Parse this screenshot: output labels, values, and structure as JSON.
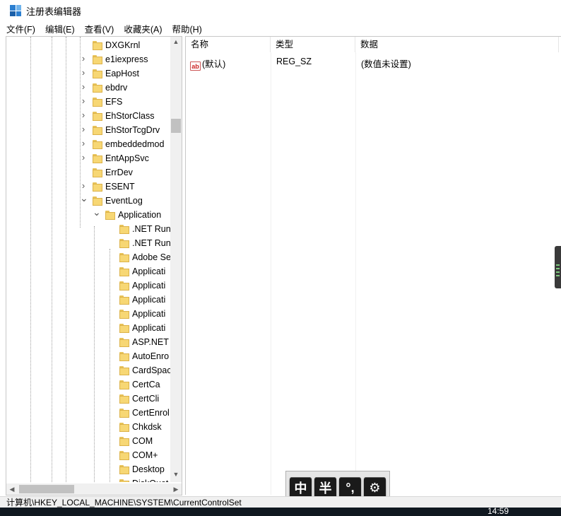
{
  "window": {
    "title": "注册表编辑器"
  },
  "menu": [
    {
      "label": "文件(F)"
    },
    {
      "label": "编辑(E)"
    },
    {
      "label": "查看(V)"
    },
    {
      "label": "收藏夹(A)"
    },
    {
      "label": "帮助(H)"
    }
  ],
  "tree": [
    {
      "label": "DXGKrnl",
      "level": 1,
      "expander": "none"
    },
    {
      "label": "e1iexpress",
      "level": 1,
      "expander": "collapsed"
    },
    {
      "label": "EapHost",
      "level": 1,
      "expander": "collapsed"
    },
    {
      "label": "ebdrv",
      "level": 1,
      "expander": "collapsed"
    },
    {
      "label": "EFS",
      "level": 1,
      "expander": "collapsed"
    },
    {
      "label": "EhStorClass",
      "level": 1,
      "expander": "collapsed"
    },
    {
      "label": "EhStorTcgDrv",
      "level": 1,
      "expander": "collapsed"
    },
    {
      "label": "embeddedmod",
      "level": 1,
      "expander": "collapsed"
    },
    {
      "label": "EntAppSvc",
      "level": 1,
      "expander": "collapsed"
    },
    {
      "label": "ErrDev",
      "level": 1,
      "expander": "none"
    },
    {
      "label": "ESENT",
      "level": 1,
      "expander": "collapsed"
    },
    {
      "label": "EventLog",
      "level": 1,
      "expander": "expanded"
    },
    {
      "label": "Application",
      "level": 2,
      "expander": "expanded"
    },
    {
      "label": ".NET Run",
      "level": 3,
      "expander": "none"
    },
    {
      "label": ".NET Run",
      "level": 3,
      "expander": "none"
    },
    {
      "label": "Adobe Se",
      "level": 3,
      "expander": "none"
    },
    {
      "label": "Applicati",
      "level": 3,
      "expander": "none"
    },
    {
      "label": "Applicati",
      "level": 3,
      "expander": "none"
    },
    {
      "label": "Applicati",
      "level": 3,
      "expander": "none"
    },
    {
      "label": "Applicati",
      "level": 3,
      "expander": "none"
    },
    {
      "label": "Applicati",
      "level": 3,
      "expander": "none"
    },
    {
      "label": "ASP.NET",
      "level": 3,
      "expander": "none"
    },
    {
      "label": "AutoEnro",
      "level": 3,
      "expander": "none"
    },
    {
      "label": "CardSpac",
      "level": 3,
      "expander": "none"
    },
    {
      "label": "CertCa",
      "level": 3,
      "expander": "none"
    },
    {
      "label": "CertCli",
      "level": 3,
      "expander": "none"
    },
    {
      "label": "CertEnrol",
      "level": 3,
      "expander": "none"
    },
    {
      "label": "Chkdsk",
      "level": 3,
      "expander": "none"
    },
    {
      "label": "COM",
      "level": 3,
      "expander": "none"
    },
    {
      "label": "COM+",
      "level": 3,
      "expander": "none"
    },
    {
      "label": "Desktop",
      "level": 3,
      "expander": "none"
    },
    {
      "label": "DiskQuot",
      "level": 3,
      "expander": "none"
    }
  ],
  "columns": [
    {
      "label": "名称"
    },
    {
      "label": "类型"
    },
    {
      "label": "数据"
    }
  ],
  "values": [
    {
      "name": "(默认)",
      "type": "REG_SZ",
      "data": "(数值未设置)",
      "icon": "ab"
    }
  ],
  "status": {
    "path": "计算机\\HKEY_LOCAL_MACHINE\\SYSTEM\\CurrentControlSet"
  },
  "ime": {
    "buttons": [
      "中",
      "半",
      "°,",
      "⚙"
    ]
  },
  "clock": {
    "time": "14:59"
  },
  "colors": {
    "folder": "#f7d774",
    "accent": "#2c7fd0"
  }
}
